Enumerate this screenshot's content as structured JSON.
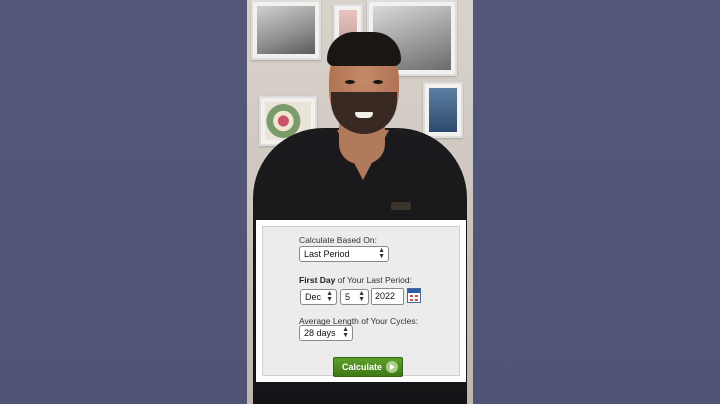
{
  "calculator": {
    "based_on_label": "Calculate Based On:",
    "based_on_value": "Last Period",
    "first_day_bold": "First Day",
    "first_day_rest": " of Your Last Period:",
    "month_value": "Dec",
    "day_value": "5",
    "year_value": "2022",
    "cycle_label": "Average Length of Your Cycles:",
    "cycle_value": "28 days",
    "calculate_label": "Calculate"
  },
  "icons": {
    "calendar": "calendar-icon",
    "select_arrows": "updown-arrows-icon",
    "go_arrow": "arrow-right-circle-icon"
  },
  "colors": {
    "background": "#525679",
    "button_green": "#4a8a1f",
    "panel": "#ececec"
  }
}
